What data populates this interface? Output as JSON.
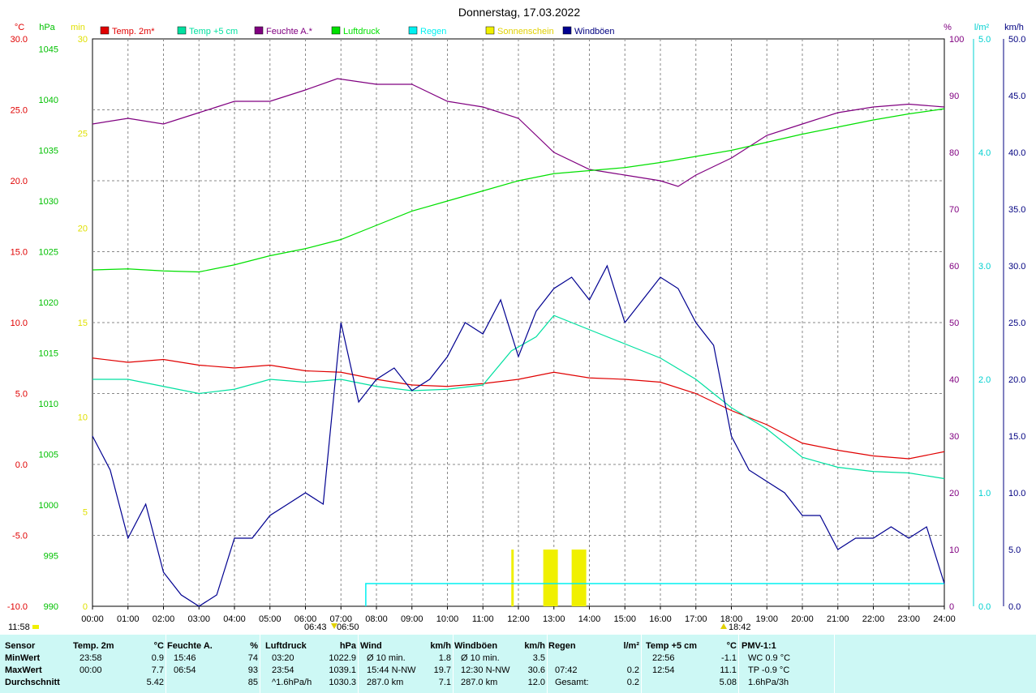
{
  "title": "Donnerstag, 17.03.2022",
  "legend": [
    {
      "name": "Temp. 2m*",
      "color": "#e00000"
    },
    {
      "name": "Temp +5 cm",
      "color": "#00e0a0"
    },
    {
      "name": "Feuchte A.*",
      "color": "#800080"
    },
    {
      "name": "Luftdruck",
      "color": "#00e000"
    },
    {
      "name": "Regen",
      "color": "#00f0f0"
    },
    {
      "name": "Sonnenschein",
      "color": "#f0f000"
    },
    {
      "name": "Windböen",
      "color": "#000090"
    }
  ],
  "axis_units": {
    "temp": "°C",
    "pressure": "hPa",
    "sun": "min",
    "humidity": "%",
    "rain": "l/m²",
    "wind": "km/h"
  },
  "markers": {
    "left1": "11:58",
    "left2": "06:43",
    "left3": "06:50",
    "right": "18:42"
  },
  "chart_data": {
    "type": "line",
    "x_label": "time",
    "x_ticks": [
      "00:00",
      "01:00",
      "02:00",
      "03:00",
      "04:00",
      "05:00",
      "06:00",
      "07:00",
      "08:00",
      "09:00",
      "10:00",
      "11:00",
      "12:00",
      "13:00",
      "14:00",
      "15:00",
      "16:00",
      "17:00",
      "18:00",
      "19:00",
      "20:00",
      "21:00",
      "22:00",
      "23:00",
      "24:00"
    ],
    "axes": {
      "temp": {
        "range": [
          -10,
          30
        ],
        "ticks": [
          "30.0",
          "25.0",
          "20.0",
          "15.0",
          "10.0",
          "5.0",
          "0.0",
          "-5.0",
          "-10.0"
        ],
        "color": "#e00000"
      },
      "pressure": {
        "range": [
          990,
          1046
        ],
        "ticks": [
          "1045",
          "1040",
          "1035",
          "1030",
          "1025",
          "1020",
          "1015",
          "1010",
          "1005",
          "1000",
          "995",
          "990"
        ],
        "color": "#00c000"
      },
      "sun": {
        "range": [
          0,
          30
        ],
        "ticks": [
          "30",
          "25",
          "20",
          "15",
          "10",
          "5",
          "0"
        ],
        "color": "#e0e000"
      },
      "humidity": {
        "range": [
          0,
          100
        ],
        "ticks": [
          "100",
          "90",
          "80",
          "70",
          "60",
          "50",
          "40",
          "30",
          "20",
          "10",
          "0"
        ],
        "color": "#800080"
      },
      "rain": {
        "range": [
          0,
          5
        ],
        "ticks": [
          "5.0",
          "4.0",
          "3.0",
          "2.0",
          "1.0",
          "0.0"
        ],
        "color": "#00d0d0"
      },
      "wind": {
        "range": [
          0,
          50
        ],
        "ticks": [
          "50.0",
          "45.0",
          "40.0",
          "35.0",
          "30.0",
          "25.0",
          "20.0",
          "15.0",
          "10.0",
          "5.0",
          "0.0"
        ],
        "color": "#000080"
      }
    },
    "series": [
      {
        "name": "Temp. 2m*",
        "axis": "temp",
        "x": [
          0,
          1,
          2,
          3,
          4,
          5,
          6,
          7,
          8,
          9,
          10,
          11,
          12,
          13,
          14,
          15,
          16,
          17,
          18,
          19,
          20,
          21,
          22,
          23,
          24
        ],
        "y": [
          7.5,
          7.2,
          7.4,
          7.0,
          6.8,
          7.0,
          6.6,
          6.5,
          6.0,
          5.6,
          5.5,
          5.7,
          6.0,
          6.5,
          6.1,
          6.0,
          5.8,
          5.0,
          3.8,
          2.8,
          1.5,
          1.0,
          0.6,
          0.4,
          0.9
        ]
      },
      {
        "name": "Temp +5 cm",
        "axis": "temp",
        "x": [
          0,
          1,
          2,
          3,
          4,
          5,
          6,
          7,
          8,
          9,
          10,
          11,
          11.8,
          12.5,
          13,
          14,
          15,
          16,
          17,
          18,
          19,
          20,
          21,
          22,
          23,
          24
        ],
        "y": [
          6.0,
          6.0,
          5.5,
          5.0,
          5.3,
          6.0,
          5.8,
          6.0,
          5.5,
          5.2,
          5.3,
          5.6,
          8.0,
          9.0,
          10.5,
          9.5,
          8.5,
          7.5,
          6.0,
          4.0,
          2.5,
          0.5,
          -0.2,
          -0.5,
          -0.6,
          -1.0
        ]
      },
      {
        "name": "Feuchte A.*",
        "axis": "humidity",
        "x": [
          0,
          1,
          2,
          3,
          3.5,
          4,
          5,
          6,
          6.9,
          8,
          9,
          10,
          11,
          12,
          13,
          14,
          15,
          16,
          16.5,
          17,
          18,
          19,
          20,
          21,
          22,
          23,
          24
        ],
        "y": [
          85,
          86,
          85,
          87,
          88,
          89,
          89,
          91,
          93,
          92,
          92,
          89,
          88,
          86,
          80,
          77,
          76,
          75,
          74,
          76,
          79,
          83,
          85,
          87,
          88,
          88.5,
          88
        ]
      },
      {
        "name": "Luftdruck",
        "axis": "pressure",
        "x": [
          0,
          1,
          2,
          3,
          4,
          5,
          6,
          7,
          8,
          9,
          10,
          11,
          12,
          13,
          14,
          15,
          16,
          17,
          18,
          19,
          20,
          21,
          22,
          23,
          24
        ],
        "y": [
          1023.2,
          1023.3,
          1023.1,
          1023.0,
          1023.7,
          1024.6,
          1025.3,
          1026.2,
          1027.6,
          1029.0,
          1030.0,
          1031.0,
          1032.0,
          1032.7,
          1033.0,
          1033.3,
          1033.8,
          1034.4,
          1035.0,
          1035.8,
          1036.6,
          1037.3,
          1038.0,
          1038.6,
          1039.1
        ]
      },
      {
        "name": "Windböen",
        "axis": "wind",
        "x": [
          0,
          0.5,
          1,
          1.5,
          2,
          2.5,
          3,
          3.5,
          4,
          4.5,
          5,
          5.5,
          6,
          6.5,
          7,
          7.5,
          8,
          8.5,
          9,
          9.5,
          10,
          10.5,
          11,
          11.5,
          12,
          12.5,
          13,
          13.5,
          14,
          14.5,
          15,
          15.5,
          16,
          16.5,
          17,
          17.5,
          18,
          18.5,
          19,
          19.5,
          20,
          20.5,
          21,
          21.5,
          22,
          22.5,
          23,
          23.5,
          24
        ],
        "y": [
          15,
          12,
          6,
          9,
          3,
          1,
          0,
          1,
          6,
          6,
          8,
          9,
          10,
          9,
          25,
          18,
          20,
          21,
          19,
          20,
          22,
          25,
          24,
          27,
          22,
          26,
          28,
          29,
          27,
          30,
          25,
          27,
          29,
          28,
          25,
          23,
          15,
          12,
          11,
          10,
          8,
          8,
          5,
          6,
          6,
          7,
          6,
          7,
          2
        ]
      }
    ],
    "rain": {
      "axis": "rain",
      "x": [
        7.7,
        24
      ],
      "y": [
        0.2,
        0.2
      ]
    },
    "sunshine": {
      "axis": "sun",
      "x": [
        11.8,
        12.7,
        13.5
      ],
      "y": [
        3,
        3,
        3
      ]
    }
  },
  "summary": {
    "rows": [
      "Sensor",
      "MinWert",
      "MaxWert",
      "Durchschnitt"
    ],
    "columns": [
      {
        "h": "Temp. 2m",
        "u": "°C",
        "r": [
          [
            "23:58",
            "0.9"
          ],
          [
            "00:00",
            "7.7"
          ],
          [
            "",
            "5.42"
          ]
        ]
      },
      {
        "h": "Feuchte A.",
        "u": "%",
        "r": [
          [
            "15:46",
            "74"
          ],
          [
            "06:54",
            "93"
          ],
          [
            "",
            "85"
          ]
        ]
      },
      {
        "h": "Luftdruck",
        "u": "hPa",
        "r": [
          [
            "03:20",
            "1022.9"
          ],
          [
            "23:54",
            "1039.1"
          ],
          [
            "^1.6hPa/h",
            "1030.3"
          ]
        ]
      },
      {
        "h": "Wind",
        "u": "km/h",
        "r": [
          [
            "Ø 10 min.",
            "1.8"
          ],
          [
            "15:44  N-NW",
            "19.7"
          ],
          [
            "287.0 km",
            "7.1"
          ]
        ]
      },
      {
        "h": "Windböen",
        "u": "km/h",
        "r": [
          [
            "Ø 10 min.",
            "3.5"
          ],
          [
            "12:30  N-NW",
            "30.6"
          ],
          [
            "287.0 km",
            "12.0"
          ]
        ]
      },
      {
        "h": "Regen",
        "u": "l/m²",
        "r": [
          [
            "",
            ""
          ],
          [
            "07:42",
            "0.2"
          ],
          [
            "Gesamt:",
            "0.2"
          ]
        ]
      },
      {
        "h": "Temp +5 cm",
        "u": "°C",
        "r": [
          [
            "22:56",
            "-1.1"
          ],
          [
            "12:54",
            "11.1"
          ],
          [
            "",
            "5.08"
          ]
        ]
      },
      {
        "h": "PMV-1:1",
        "u": "",
        "r": [
          [
            "WC 0.9 °C",
            ""
          ],
          [
            "TP -0.9 °C",
            ""
          ],
          [
            "1.6hPa/3h",
            ""
          ]
        ]
      }
    ]
  }
}
